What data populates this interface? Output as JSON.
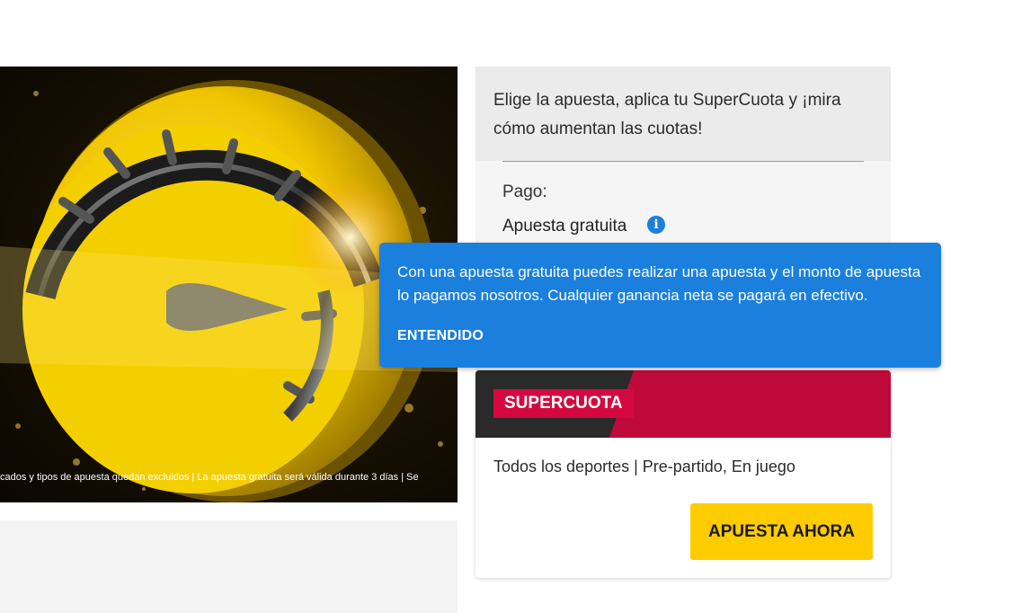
{
  "hero": {
    "caption": "cados y tipos de apuesta quedan excluidos | La apuesta gratuita será válida durante 3 días | Se"
  },
  "promo": {
    "description": "Elige la apuesta, aplica tu SuperCuota y ¡mira cómo aumentan las cuotas!",
    "payment_label": "Pago:",
    "payment_value": "Apuesta gratuita",
    "info_icon_glyph": "i"
  },
  "tooltip": {
    "text": "Con una apuesta gratuita puedes realizar una apuesta y el monto de apuesta lo pagamos nosotros. Cualquier ganancia neta se pagará en efectivo.",
    "button_label": "ENTENDIDO"
  },
  "card": {
    "tag_label": "SUPERCUOTA",
    "sports": "Todos los deportes | Pre-partido, En juego",
    "cta_label": "APUESTA AHORA"
  },
  "colors": {
    "tooltip_blue": "#1a7fdd",
    "supercuota_red": "#c0093b",
    "cta_yellow": "#ffcc00"
  }
}
